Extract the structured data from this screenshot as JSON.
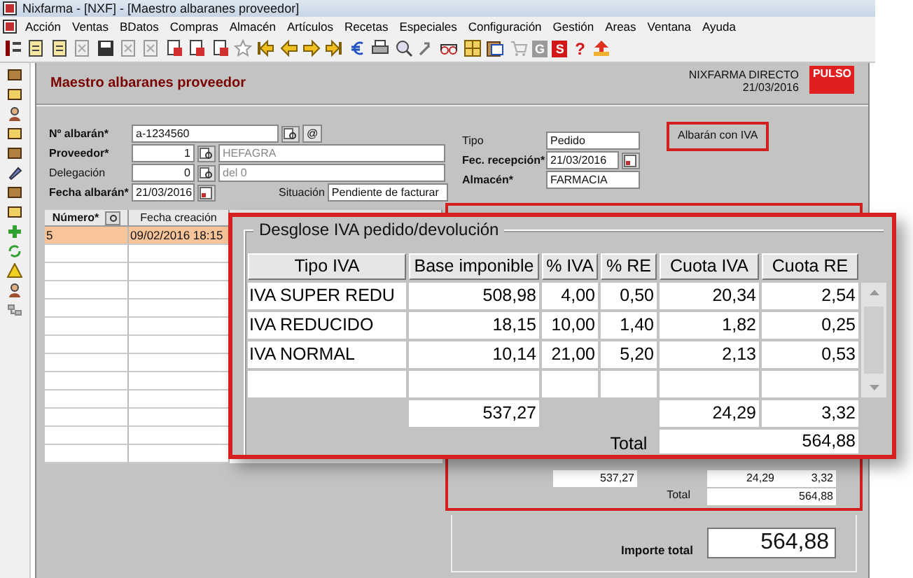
{
  "window": {
    "title": "Nixfarma - [NXF] - [Maestro albaranes proveedor]"
  },
  "menu": [
    "Acción",
    "Ventas",
    "BDatos",
    "Compras",
    "Almacén",
    "Artículos",
    "Recetas",
    "Especiales",
    "Configuración",
    "Gestión",
    "Areas",
    "Ventana",
    "Ayuda"
  ],
  "toolbar": [
    {
      "kind": "list"
    },
    {
      "kind": "doc"
    },
    {
      "kind": "doc-edit"
    },
    {
      "kind": "gear-grey"
    },
    {
      "kind": "save"
    },
    {
      "kind": "doc-grey"
    },
    {
      "kind": "doc-grey"
    },
    {
      "kind": "doc-red"
    },
    {
      "kind": "doc-red"
    },
    {
      "kind": "doc-red"
    },
    {
      "kind": "star"
    },
    {
      "kind": "arrow-first"
    },
    {
      "kind": "arrow-left"
    },
    {
      "kind": "arrow-right"
    },
    {
      "kind": "arrow-last"
    },
    {
      "kind": "euro"
    },
    {
      "kind": "printer"
    },
    {
      "kind": "search"
    },
    {
      "kind": "tools"
    },
    {
      "kind": "glasses"
    },
    {
      "kind": "grid"
    },
    {
      "kind": "clipboard"
    },
    {
      "kind": "cart"
    },
    {
      "kind": "letter",
      "glyph": "G",
      "color": "#9a9a9a"
    },
    {
      "kind": "letter",
      "glyph": "S",
      "color": "#d01818"
    },
    {
      "kind": "glyph",
      "glyph": "?",
      "color": "#d01818"
    },
    {
      "kind": "upload"
    }
  ],
  "header": {
    "title": "Maestro albaranes proveedor",
    "company": "NIXFARMA DIRECTO",
    "date": "21/03/2016",
    "logo": "PULSO"
  },
  "form": {
    "albaran": {
      "label": "Nº albarán*",
      "value": "a-1234560",
      "email_button": "@"
    },
    "proveedor": {
      "label": "Proveedor*",
      "code": "1",
      "name": "HEFAGRA",
      "bold": true
    },
    "delegacion": {
      "label": "Delegación",
      "code": "0",
      "name": "del 0",
      "bold": false
    },
    "fecha_albaran": {
      "label": "Fecha albarán*",
      "value": "21/03/2016"
    },
    "situacion": {
      "label": "Situación",
      "value": "Pendiente de facturar"
    },
    "tipo": {
      "label": "Tipo",
      "value": "Pedido",
      "bold": false
    },
    "fec_recepcion": {
      "label": "Fec. recepción*",
      "value": "21/03/2016"
    },
    "almacen": {
      "label": "Almacén*",
      "value": "FARMACIA",
      "bold": true
    }
  },
  "iva_badge": "Albarán con IVA",
  "orders_grid": {
    "columns": [
      "Número*",
      "Fecha creación"
    ],
    "rows": [
      {
        "numero": "5",
        "fecha": "09/02/2016 18:15",
        "selected": true
      }
    ]
  },
  "background_totals": {
    "base": "537,27",
    "cuota_iva": "24,29",
    "cuota_re": "3,32",
    "total_label": "Total",
    "total": "564,88"
  },
  "importe_total": {
    "label": "Importe total",
    "value": "564,88"
  },
  "callout": {
    "legend": "Desglose IVA pedido/devolución",
    "columns": [
      "Tipo IVA",
      "Base imponible",
      "% IVA",
      "% RE",
      "Cuota IVA",
      "Cuota RE"
    ],
    "rows": [
      [
        "IVA SUPER REDU",
        "508,98",
        "4,00",
        "0,50",
        "20,34",
        "2,54"
      ],
      [
        "IVA REDUCIDO",
        "18,15",
        "10,00",
        "1,40",
        "1,82",
        "0,25"
      ],
      [
        "IVA NORMAL",
        "10,14",
        "21,00",
        "5,20",
        "2,13",
        "0,53"
      ]
    ],
    "totals": {
      "base": "537,27",
      "cuota_iva": "24,29",
      "cuota_re": "3,32"
    },
    "total_label": "Total",
    "total": "564,88"
  }
}
